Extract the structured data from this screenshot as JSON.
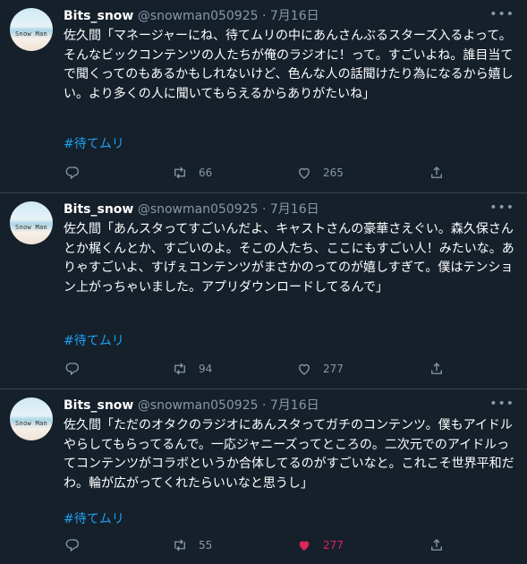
{
  "tweets": [
    {
      "name": "Bits_snow",
      "handle": "@snowman050925",
      "date": "7月16日",
      "avatar_text": "Snow Man",
      "text": "佐久間「マネージャーにね、待てムリの中にあんさんぶるスターズ入るよって。そんなビックコンテンツの人たちが俺のラジオに！って。すごいよね。誰目当てで聞くってのもあるかもしれないけど、色んな人の話聞けたり為になるから嬉しい。より多くの人に聞いてもらえるからありがたいね」",
      "hashtag": "#待てムリ",
      "retweets": "66",
      "likes": "265",
      "liked": false
    },
    {
      "name": "Bits_snow",
      "handle": "@snowman050925",
      "date": "7月16日",
      "avatar_text": "Snow Man",
      "text": "佐久間「あんスタってすごいんだよ、キャストさんの豪華さえぐい。森久保さんとか梶くんとか、すごいのよ。そこの人たち、ここにもすごい人！みたいな。ありゃすごいよ、すげぇコンテンツがまさかのってのが嬉しすぎて。僕はテンション上がっちゃいました。アプリダウンロードしてるんで」",
      "hashtag": "#待てムリ",
      "retweets": "94",
      "likes": "277",
      "liked": false
    },
    {
      "name": "Bits_snow",
      "handle": "@snowman050925",
      "date": "7月16日",
      "avatar_text": "Snow Man",
      "text": "佐久間「ただのオタクのラジオにあんスタってガチのコンテンツ。僕もアイドルやらしてもらってるんで。一応ジャニーズってところの。二次元でのアイドルってコンテンツがコラボというか合体してるのがすごいなと。これこそ世界平和だわ。輪が広がってくれたらいいなと思うし」",
      "hashtag": "#待てムリ",
      "retweets": "55",
      "likes": "277",
      "liked": true
    }
  ],
  "colors": {
    "background": "#15202b",
    "text": "#ffffff",
    "muted": "#8899a6",
    "link": "#1da1f2",
    "like_active": "#e0245e",
    "divider": "#38444d"
  }
}
